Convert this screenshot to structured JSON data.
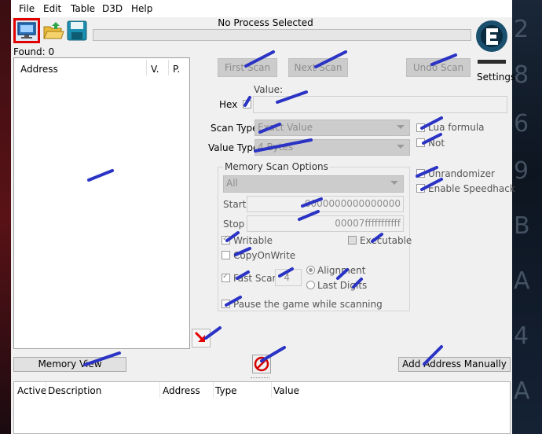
{
  "menu": [
    "File",
    "Edit",
    "Table",
    "D3D",
    "Help"
  ],
  "process_title": "No Process Selected",
  "found": "Found: 0",
  "found_list": {
    "headers": [
      "Address",
      "V.",
      "P."
    ]
  },
  "scan_buttons": {
    "first": "First Scan",
    "next": "Next Scan",
    "undo": "Undo Scan"
  },
  "settings_label": "Settings",
  "value_label": "Value:",
  "hex_label": "Hex",
  "scan_type": {
    "label": "Scan Type",
    "value": "Exact Value"
  },
  "value_type": {
    "label": "Value Type",
    "value": "4 Bytes"
  },
  "right_options": {
    "lua": "Lua formula",
    "not": "Not",
    "unrandomizer": "Unrandomizer",
    "speedhack": "Enable Speedhack"
  },
  "memory_scan": {
    "title": "Memory Scan Options",
    "region": "All",
    "start_label": "Start",
    "start_value": "0000000000000000",
    "stop_label": "Stop",
    "stop_value": "00007fffffffffff",
    "writable": "Writable",
    "executable": "Executable",
    "copyonwrite": "CopyOnWrite",
    "fastscan": "Fast Scan",
    "fastscan_value": "4",
    "alignment": "Alignment",
    "lastdigits": "Last Digits",
    "pause": "Pause the game while scanning"
  },
  "memory_view": "Memory View",
  "add_address": "Add Address Manually",
  "address_table": {
    "headers": [
      "Active",
      "Description",
      "Address",
      "Type",
      "Value"
    ]
  },
  "colors": {
    "accent_scribble": "#2a33c4",
    "highlight": "#e60000"
  },
  "icons": [
    "computer-icon",
    "open-folder-icon",
    "save-disk-icon",
    "arrow-down-right-icon",
    "no-entry-icon",
    "cheat-engine-logo"
  ]
}
